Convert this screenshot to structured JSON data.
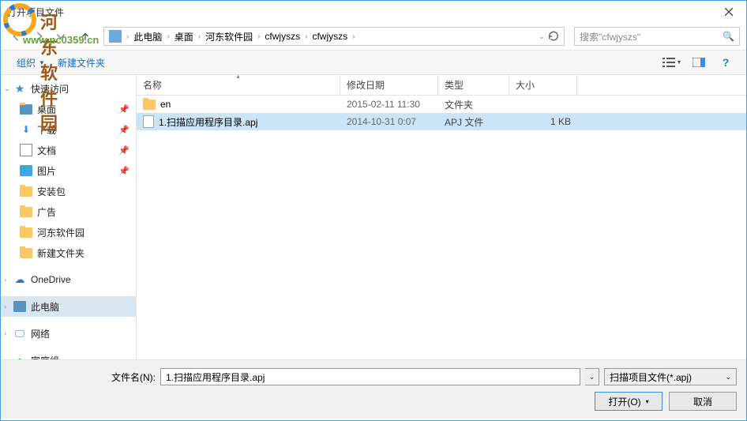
{
  "window": {
    "title": "打开项目文件"
  },
  "watermark": {
    "brand": "河东软件园",
    "url": "www.pc0359.cn"
  },
  "breadcrumb": {
    "items": [
      "此电脑",
      "桌面",
      "河东软件园",
      "cfwjyszs",
      "cfwjyszs"
    ]
  },
  "search": {
    "placeholder": "搜索\"cfwjyszs\""
  },
  "toolbar": {
    "organize": "组织",
    "new_folder": "新建文件夹"
  },
  "sidebar": {
    "quick_access": "快速访问",
    "items": [
      {
        "label": "桌面",
        "pinned": true
      },
      {
        "label": "下载",
        "pinned": true
      },
      {
        "label": "文档",
        "pinned": true
      },
      {
        "label": "图片",
        "pinned": true
      },
      {
        "label": "安装包",
        "pinned": false
      },
      {
        "label": "广告",
        "pinned": false
      },
      {
        "label": "河东软件园",
        "pinned": false
      },
      {
        "label": "新建文件夹",
        "pinned": false
      }
    ],
    "onedrive": "OneDrive",
    "this_pc": "此电脑",
    "network": "网络",
    "homegroup": "家庭组"
  },
  "columns": {
    "name": "名称",
    "date": "修改日期",
    "type": "类型",
    "size": "大小"
  },
  "files": [
    {
      "name": "en",
      "date": "2015-02-11  11:30",
      "type": "文件夹",
      "size": "",
      "is_folder": true,
      "selected": false
    },
    {
      "name": "1.扫描应用程序目录.apj",
      "date": "2014-10-31  0:07",
      "type": "APJ 文件",
      "size": "1 KB",
      "is_folder": false,
      "selected": true
    }
  ],
  "footer": {
    "filename_label": "文件名(N):",
    "filename_value": "1.扫描应用程序目录.apj",
    "filter": "扫描项目文件(*.apj)",
    "open": "打开(O)",
    "cancel": "取消"
  }
}
